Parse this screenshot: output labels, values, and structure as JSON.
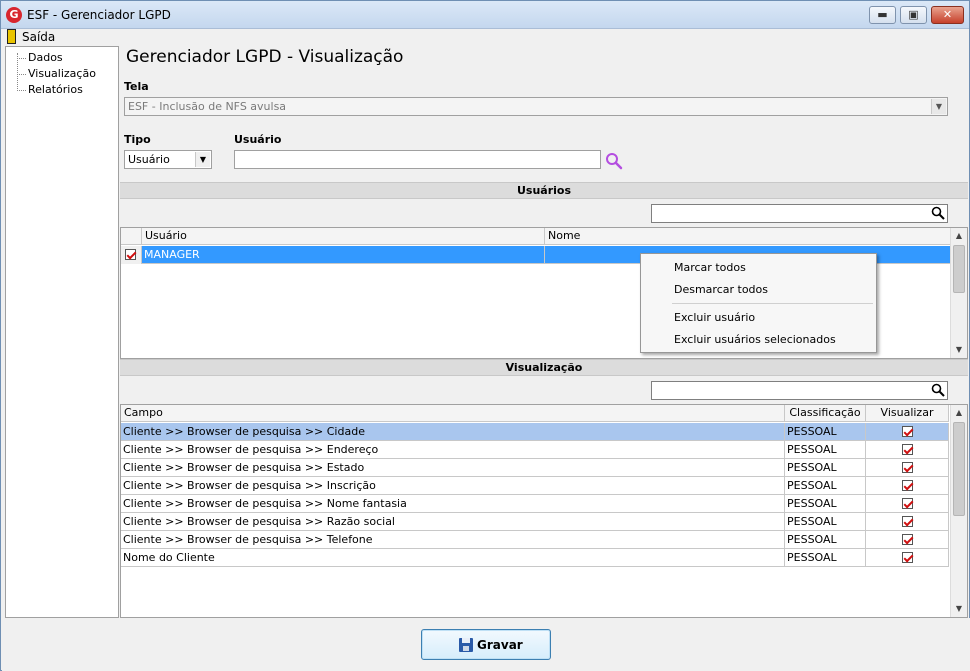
{
  "window": {
    "title": "ESF - Gerenciador LGPD",
    "app_icon": "G"
  },
  "titlebar_buttons": {
    "minimize": "▬",
    "maximize": "▣",
    "close": "✕"
  },
  "menu": {
    "exit_label": "Saída"
  },
  "tree": {
    "items": [
      "Dados",
      "Visualização",
      "Relatórios"
    ]
  },
  "page": {
    "title": "Gerenciador LGPD - Visualização"
  },
  "tela": {
    "label": "Tela",
    "value": "ESF - Inclusão de NFS avulsa"
  },
  "tipo": {
    "label": "Tipo",
    "value": "Usuário"
  },
  "usuario": {
    "label": "Usuário",
    "value": ""
  },
  "usuarios_section": {
    "title": "Usuários",
    "filter_value": "",
    "columns": [
      "Usuário",
      "Nome"
    ],
    "rows": [
      {
        "usuario": "MANAGER",
        "nome": "",
        "checked": true
      }
    ]
  },
  "context_menu": {
    "items": [
      "Marcar todos",
      "Desmarcar todos",
      "Excluir usuário",
      "Excluir usuários selecionados"
    ]
  },
  "visualizacao_section": {
    "title": "Visualização",
    "filter_value": "",
    "columns": [
      "Campo",
      "Classificação",
      "Visualizar"
    ],
    "rows": [
      {
        "campo": "Cliente >> Browser de pesquisa >> Cidade",
        "classificacao": "PESSOAL",
        "visualizar": true
      },
      {
        "campo": "Cliente >> Browser de pesquisa >> Endereço",
        "classificacao": "PESSOAL",
        "visualizar": true
      },
      {
        "campo": "Cliente >> Browser de pesquisa >> Estado",
        "classificacao": "PESSOAL",
        "visualizar": true
      },
      {
        "campo": "Cliente >> Browser de pesquisa >> Inscrição",
        "classificacao": "PESSOAL",
        "visualizar": true
      },
      {
        "campo": "Cliente >> Browser de pesquisa >> Nome fantasia",
        "classificacao": "PESSOAL",
        "visualizar": true
      },
      {
        "campo": "Cliente >> Browser de pesquisa >> Razão social",
        "classificacao": "PESSOAL",
        "visualizar": true
      },
      {
        "campo": "Cliente >> Browser de pesquisa >> Telefone",
        "classificacao": "PESSOAL",
        "visualizar": true
      },
      {
        "campo": "Nome do Cliente",
        "classificacao": "PESSOAL",
        "visualizar": true
      }
    ]
  },
  "actions": {
    "save_label": "Gravar"
  },
  "colors": {
    "selection": "#3399ff",
    "selection_light": "#a9c6ee",
    "check": "#d01010",
    "accent_icon": "#b44ee0"
  },
  "icons": {
    "search": "search-icon",
    "save": "floppy-disk-icon",
    "exit": "exit-door-icon"
  }
}
